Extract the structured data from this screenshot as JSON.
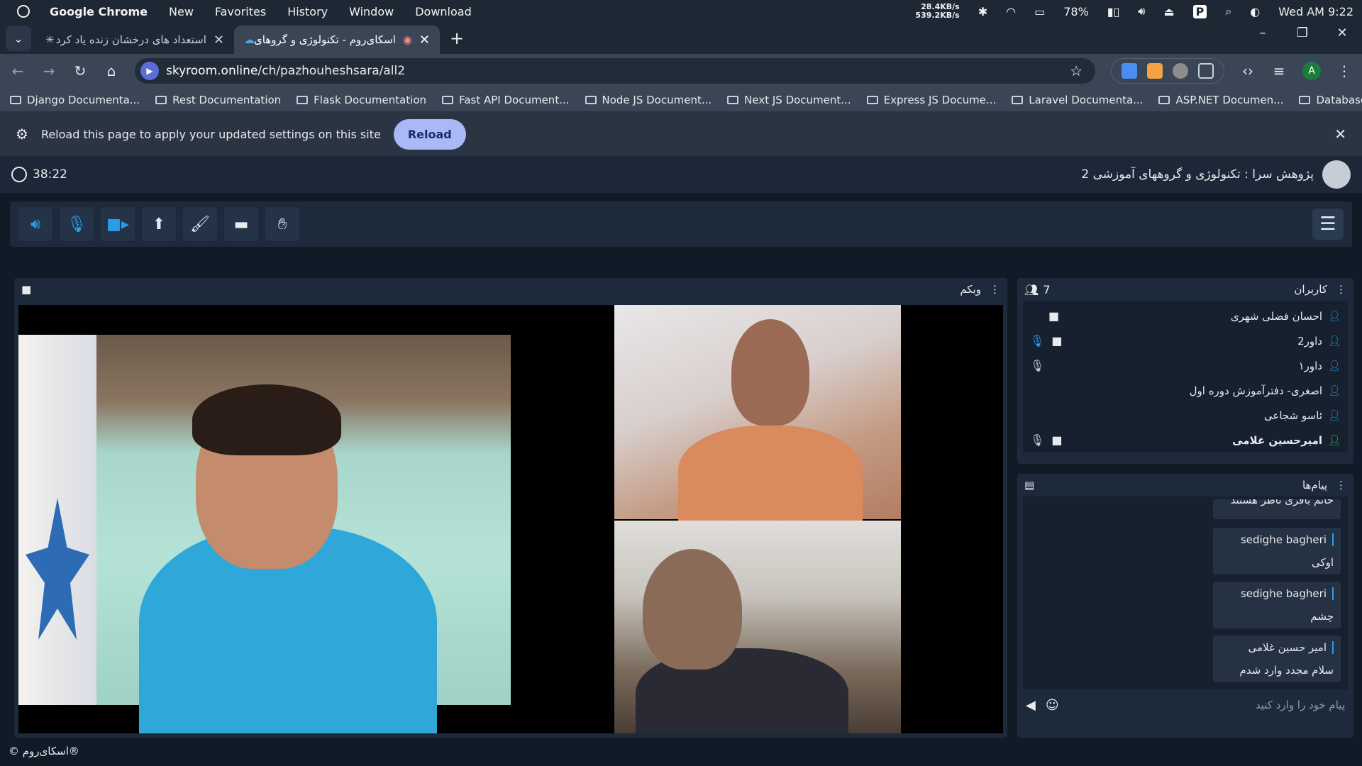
{
  "system_bar": {
    "app_name": "Google Chrome",
    "menus": [
      "New",
      "Favorites",
      "History",
      "Window",
      "Download"
    ],
    "net_up": "28.4KB/s",
    "net_down": "539.2KB/s",
    "battery": "78%",
    "clock": "Wed AM 9:22"
  },
  "tabs": [
    {
      "title": "استعداد های درخشان زنده یاد کرد",
      "active": false
    },
    {
      "title": "اسکای‌روم - تکنولوژی و گروهای",
      "active": true
    }
  ],
  "omnibar": {
    "host": "skyroom.online",
    "path": "/ch/pazhouheshsara/all2",
    "profile_initial": "A"
  },
  "bookmarks": [
    "Django Documenta...",
    "Rest Documentation",
    "Flask Documentation",
    "Fast API Document...",
    "Node JS Document...",
    "Next JS Document...",
    "Express JS Docume...",
    "Laravel Documenta...",
    "ASP.NET Documen...",
    "Database"
  ],
  "infobar": {
    "message": "Reload this page to apply your updated settings on this site",
    "button": "Reload"
  },
  "room": {
    "timer": "38:22",
    "title": "پژوهش سرا : تکنولوژی و گروههای آموزشی 2"
  },
  "webcam_panel": {
    "title": "وبکم"
  },
  "users_panel": {
    "title": "کاربران",
    "count": "7",
    "users": [
      {
        "name": "احسان فضلی شهری",
        "mic": false,
        "cam": true,
        "me": false
      },
      {
        "name": "داور2",
        "mic": true,
        "cam": true,
        "me": false
      },
      {
        "name": "داور۱",
        "mic": true,
        "cam": false,
        "me": false
      },
      {
        "name": "اصغری- دفترآموزش دوره اول",
        "mic": false,
        "cam": false,
        "me": false
      },
      {
        "name": "ئاسو شجاعی",
        "mic": false,
        "cam": false,
        "me": false
      },
      {
        "name": "امیرحسین غلامی",
        "mic": true,
        "cam": true,
        "me": true
      }
    ]
  },
  "messages_panel": {
    "title": "پیام‌ها",
    "cut_message": "خانم باقری ناظر هستند",
    "messages": [
      {
        "sender": "sedighe bagheri",
        "text": "اوکی"
      },
      {
        "sender": "sedighe bagheri",
        "text": "چشم"
      },
      {
        "sender": "امیر حسین غلامی",
        "text": "سلام مجدد وارد شدم"
      }
    ],
    "input_placeholder": "پیام خود را وارد کنید"
  },
  "footer": {
    "text": "© اسکای‌روم®"
  },
  "colors": {
    "accent": "#2a9de8",
    "panel_bg": "#1c2a3c",
    "page_bg": "#111b28",
    "reload_button": "#a8b9f5"
  }
}
